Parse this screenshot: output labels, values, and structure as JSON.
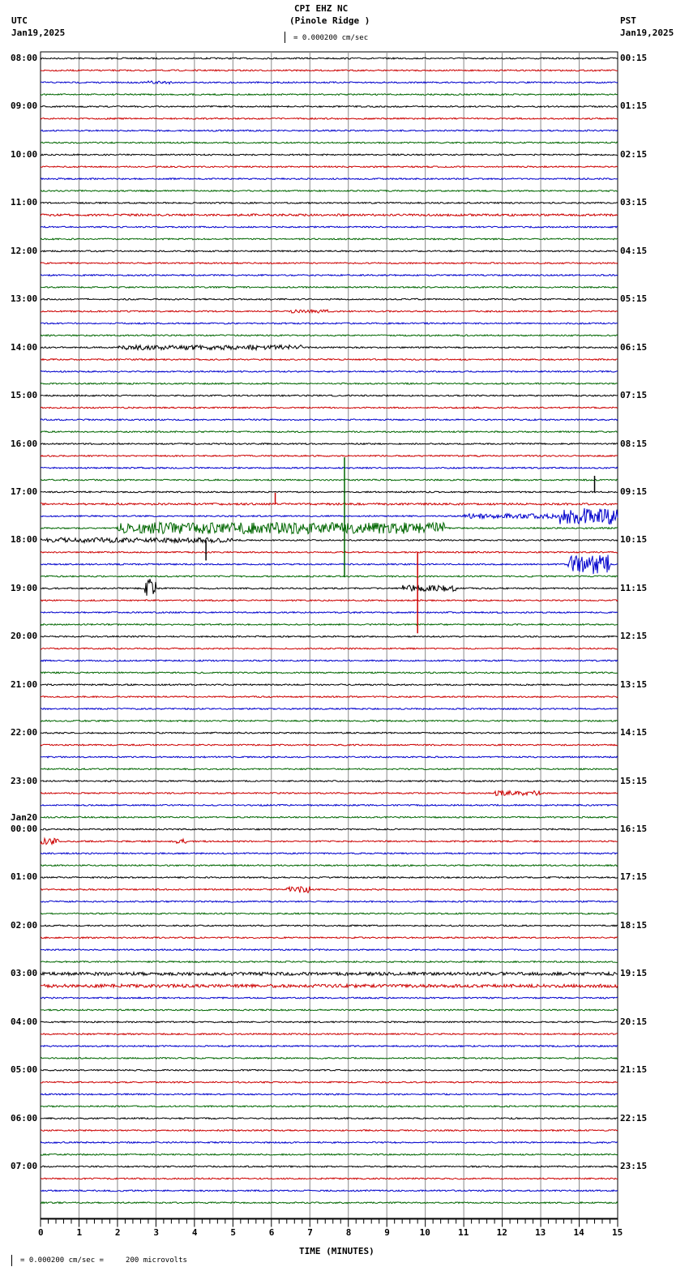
{
  "header": {
    "title": "CPI EHZ NC",
    "subtitle": "(Pinole Ridge )",
    "left_tz": "UTC",
    "left_date": "Jan19,2025",
    "right_tz": "PST",
    "right_date": "Jan19,2025",
    "scale": "= 0.000200 cm/sec"
  },
  "footer": {
    "scale": "= 0.000200 cm/sec =     200 microvolts"
  },
  "chart_data": {
    "type": "line",
    "title": "CPI EHZ NC (Pinole Ridge )",
    "xlabel": "TIME (MINUTES)",
    "xlim": [
      0,
      15
    ],
    "x_ticks": [
      "0",
      "1",
      "2",
      "3",
      "4",
      "5",
      "6",
      "7",
      "8",
      "9",
      "10",
      "11",
      "12",
      "13",
      "14",
      "15"
    ],
    "traces_per_hour": 4,
    "trace_colors": [
      "#000000",
      "#cc0000",
      "#0000cc",
      "#006600"
    ],
    "utc_labels": [
      "08:00",
      "09:00",
      "10:00",
      "11:00",
      "12:00",
      "13:00",
      "14:00",
      "15:00",
      "16:00",
      "17:00",
      "18:00",
      "19:00",
      "20:00",
      "21:00",
      "22:00",
      "23:00",
      "00:00",
      "01:00",
      "02:00",
      "03:00",
      "04:00",
      "05:00",
      "06:00",
      "07:00"
    ],
    "date_change": {
      "hour_index": 16,
      "label": "Jan20"
    },
    "pst_labels": [
      "00:15",
      "01:15",
      "02:15",
      "03:15",
      "04:15",
      "05:15",
      "06:15",
      "07:15",
      "08:15",
      "09:15",
      "10:15",
      "11:15",
      "12:15",
      "13:15",
      "14:15",
      "15:15",
      "16:15",
      "17:15",
      "18:15",
      "19:15",
      "20:15",
      "21:15",
      "22:15",
      "23:15"
    ],
    "events": [
      {
        "trace": 2,
        "start": 2.8,
        "end": 3.4,
        "amp": 2
      },
      {
        "trace": 13,
        "start": 0,
        "end": 15,
        "amp": 1.3
      },
      {
        "trace": 21,
        "start": 6.5,
        "end": 7.5,
        "amp": 2
      },
      {
        "trace": 24,
        "start": 2,
        "end": 6.8,
        "amp": 3
      },
      {
        "trace": 37,
        "start": 0,
        "end": 15,
        "amp": 1.2
      },
      {
        "trace": 38,
        "start": 11,
        "end": 13.5,
        "amp": 3
      },
      {
        "trace": 38,
        "start": 13.5,
        "end": 15,
        "amp": 10
      },
      {
        "trace": 39,
        "start": 2,
        "end": 10.5,
        "amp": 7
      },
      {
        "trace": 40,
        "start": 0,
        "end": 5,
        "amp": 3
      },
      {
        "trace": 42,
        "start": 13.7,
        "end": 14.8,
        "amp": 12
      },
      {
        "trace": 44,
        "start": 2.7,
        "end": 3.0,
        "amp": 12
      },
      {
        "trace": 44,
        "start": 9.4,
        "end": 10.8,
        "amp": 4
      },
      {
        "trace": 61,
        "start": 11.8,
        "end": 13,
        "amp": 3
      },
      {
        "trace": 65,
        "start": 0,
        "end": 0.5,
        "amp": 4
      },
      {
        "trace": 65,
        "start": 3.5,
        "end": 3.8,
        "amp": 3
      },
      {
        "trace": 69,
        "start": 6.4,
        "end": 7.0,
        "amp": 4
      },
      {
        "trace": 76,
        "start": 0,
        "end": 15,
        "amp": 2
      },
      {
        "trace": 77,
        "start": 0,
        "end": 15,
        "amp": 2
      }
    ],
    "spikes": [
      {
        "trace": 35,
        "minute": 7.9,
        "up": 28,
        "down": 120
      },
      {
        "trace": 37,
        "minute": 6.1,
        "up": 14,
        "down": 0
      },
      {
        "trace": 41,
        "minute": 9.8,
        "up": 0,
        "down": 100
      },
      {
        "trace": 40,
        "minute": 4.3,
        "up": 0,
        "down": 25
      },
      {
        "trace": 36,
        "minute": 14.4,
        "up": 20,
        "down": 0
      }
    ]
  }
}
